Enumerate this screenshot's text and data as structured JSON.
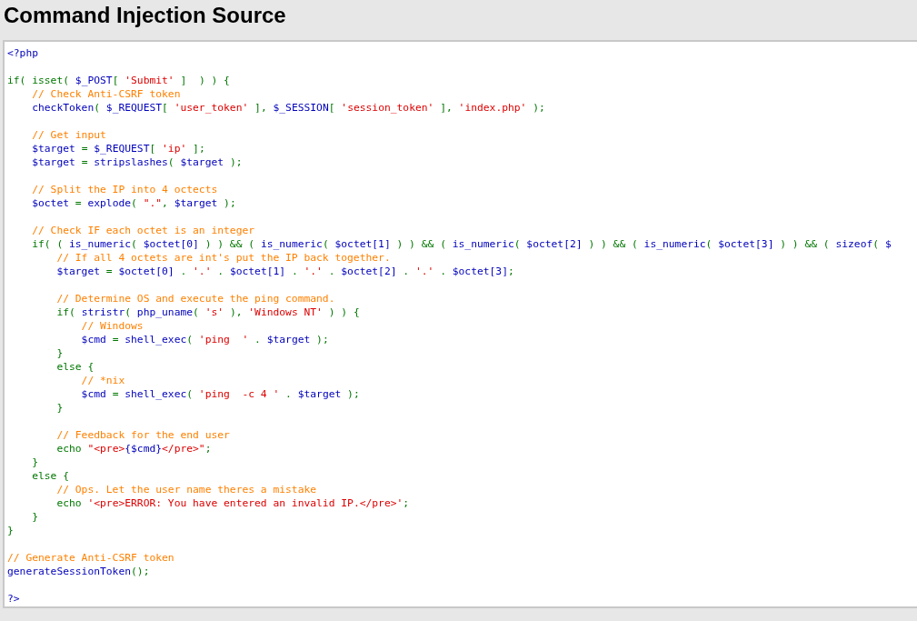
{
  "title": "Command Injection Source",
  "code_blocks": [
    [
      [
        {
          "kind": "code",
          "text": "<?php"
        }
      ]
    ],
    [
      [
        {
          "kind": "keyword",
          "text": "if( isset( "
        },
        {
          "kind": "code",
          "text": "$_POST"
        },
        {
          "kind": "keyword",
          "text": "[ "
        },
        {
          "kind": "string",
          "text": "'Submit'"
        },
        {
          "kind": "keyword",
          "text": " ]  ) ) {"
        }
      ],
      [
        {
          "kind": "comment",
          "text": "    // Check Anti-CSRF token"
        }
      ],
      [
        {
          "kind": "code",
          "text": "    checkToken"
        },
        {
          "kind": "keyword",
          "text": "( "
        },
        {
          "kind": "code",
          "text": "$_REQUEST"
        },
        {
          "kind": "keyword",
          "text": "[ "
        },
        {
          "kind": "string",
          "text": "'user_token'"
        },
        {
          "kind": "keyword",
          "text": " ], "
        },
        {
          "kind": "code",
          "text": "$_SESSION"
        },
        {
          "kind": "keyword",
          "text": "[ "
        },
        {
          "kind": "string",
          "text": "'session_token'"
        },
        {
          "kind": "keyword",
          "text": " ], "
        },
        {
          "kind": "string",
          "text": "'index.php'"
        },
        {
          "kind": "keyword",
          "text": " );"
        }
      ]
    ],
    [
      [
        {
          "kind": "comment",
          "text": "    // Get input"
        }
      ],
      [
        {
          "kind": "code",
          "text": "    $target "
        },
        {
          "kind": "keyword",
          "text": "= "
        },
        {
          "kind": "code",
          "text": "$_REQUEST"
        },
        {
          "kind": "keyword",
          "text": "[ "
        },
        {
          "kind": "string",
          "text": "'ip'"
        },
        {
          "kind": "keyword",
          "text": " ];"
        }
      ],
      [
        {
          "kind": "code",
          "text": "    $target "
        },
        {
          "kind": "keyword",
          "text": "= "
        },
        {
          "kind": "code",
          "text": "stripslashes"
        },
        {
          "kind": "keyword",
          "text": "( "
        },
        {
          "kind": "code",
          "text": "$target "
        },
        {
          "kind": "keyword",
          "text": ");"
        }
      ]
    ],
    [
      [
        {
          "kind": "comment",
          "text": "    // Split the IP into 4 octects"
        }
      ],
      [
        {
          "kind": "code",
          "text": "    $octet "
        },
        {
          "kind": "keyword",
          "text": "= "
        },
        {
          "kind": "code",
          "text": "explode"
        },
        {
          "kind": "keyword",
          "text": "( "
        },
        {
          "kind": "string",
          "text": "\".\""
        },
        {
          "kind": "keyword",
          "text": ", "
        },
        {
          "kind": "code",
          "text": "$target "
        },
        {
          "kind": "keyword",
          "text": ");"
        }
      ]
    ],
    [
      [
        {
          "kind": "comment",
          "text": "    // Check IF each octet is an integer"
        }
      ],
      [
        {
          "kind": "keyword",
          "text": "    if( ( "
        },
        {
          "kind": "code",
          "text": "is_numeric"
        },
        {
          "kind": "keyword",
          "text": "( "
        },
        {
          "kind": "code",
          "text": "$octet[0]"
        },
        {
          "kind": "keyword",
          "text": " ) ) && ( "
        },
        {
          "kind": "code",
          "text": "is_numeric"
        },
        {
          "kind": "keyword",
          "text": "( "
        },
        {
          "kind": "code",
          "text": "$octet[1]"
        },
        {
          "kind": "keyword",
          "text": " ) ) && ( "
        },
        {
          "kind": "code",
          "text": "is_numeric"
        },
        {
          "kind": "keyword",
          "text": "( "
        },
        {
          "kind": "code",
          "text": "$octet[2]"
        },
        {
          "kind": "keyword",
          "text": " ) ) && ( "
        },
        {
          "kind": "code",
          "text": "is_numeric"
        },
        {
          "kind": "keyword",
          "text": "( "
        },
        {
          "kind": "code",
          "text": "$octet[3]"
        },
        {
          "kind": "keyword",
          "text": " ) ) && ( "
        },
        {
          "kind": "code",
          "text": "sizeof"
        },
        {
          "kind": "keyword",
          "text": "( "
        },
        {
          "kind": "code",
          "text": "$"
        }
      ],
      [
        {
          "kind": "comment",
          "text": "        // If all 4 octets are int's put the IP back together."
        }
      ],
      [
        {
          "kind": "code",
          "text": "        $target "
        },
        {
          "kind": "keyword",
          "text": "= "
        },
        {
          "kind": "code",
          "text": "$octet[0] "
        },
        {
          "kind": "keyword",
          "text": ". "
        },
        {
          "kind": "string",
          "text": "'.'"
        },
        {
          "kind": "keyword",
          "text": " . "
        },
        {
          "kind": "code",
          "text": "$octet[1] "
        },
        {
          "kind": "keyword",
          "text": ". "
        },
        {
          "kind": "string",
          "text": "'.'"
        },
        {
          "kind": "keyword",
          "text": " . "
        },
        {
          "kind": "code",
          "text": "$octet[2] "
        },
        {
          "kind": "keyword",
          "text": ". "
        },
        {
          "kind": "string",
          "text": "'.'"
        },
        {
          "kind": "keyword",
          "text": " . "
        },
        {
          "kind": "code",
          "text": "$octet[3]"
        },
        {
          "kind": "keyword",
          "text": ";"
        }
      ]
    ],
    [
      [
        {
          "kind": "comment",
          "text": "        // Determine OS and execute the ping command."
        }
      ],
      [
        {
          "kind": "keyword",
          "text": "        if( "
        },
        {
          "kind": "code",
          "text": "stristr"
        },
        {
          "kind": "keyword",
          "text": "( "
        },
        {
          "kind": "code",
          "text": "php_uname"
        },
        {
          "kind": "keyword",
          "text": "( "
        },
        {
          "kind": "string",
          "text": "'s'"
        },
        {
          "kind": "keyword",
          "text": " ), "
        },
        {
          "kind": "string",
          "text": "'Windows NT'"
        },
        {
          "kind": "keyword",
          "text": " ) ) {"
        }
      ],
      [
        {
          "kind": "comment",
          "text": "            // Windows"
        }
      ],
      [
        {
          "kind": "code",
          "text": "            $cmd "
        },
        {
          "kind": "keyword",
          "text": "= "
        },
        {
          "kind": "code",
          "text": "shell_exec"
        },
        {
          "kind": "keyword",
          "text": "( "
        },
        {
          "kind": "string",
          "text": "'ping  '"
        },
        {
          "kind": "keyword",
          "text": " . "
        },
        {
          "kind": "code",
          "text": "$target "
        },
        {
          "kind": "keyword",
          "text": ");"
        }
      ],
      [
        {
          "kind": "keyword",
          "text": "        }"
        }
      ],
      [
        {
          "kind": "keyword",
          "text": "        else {"
        }
      ],
      [
        {
          "kind": "comment",
          "text": "            // *nix"
        }
      ],
      [
        {
          "kind": "code",
          "text": "            $cmd "
        },
        {
          "kind": "keyword",
          "text": "= "
        },
        {
          "kind": "code",
          "text": "shell_exec"
        },
        {
          "kind": "keyword",
          "text": "( "
        },
        {
          "kind": "string",
          "text": "'ping  -c 4 '"
        },
        {
          "kind": "keyword",
          "text": " . "
        },
        {
          "kind": "code",
          "text": "$target "
        },
        {
          "kind": "keyword",
          "text": ");"
        }
      ],
      [
        {
          "kind": "keyword",
          "text": "        }"
        }
      ]
    ],
    [
      [
        {
          "kind": "comment",
          "text": "        // Feedback for the end user"
        }
      ],
      [
        {
          "kind": "keyword",
          "text": "        echo "
        },
        {
          "kind": "string",
          "text": "\"<pre>"
        },
        {
          "kind": "code",
          "text": "{$cmd}"
        },
        {
          "kind": "string",
          "text": "</pre>\""
        },
        {
          "kind": "keyword",
          "text": ";"
        }
      ],
      [
        {
          "kind": "keyword",
          "text": "    }"
        }
      ],
      [
        {
          "kind": "keyword",
          "text": "    else {"
        }
      ],
      [
        {
          "kind": "comment",
          "text": "        // Ops. Let the user name theres a mistake"
        }
      ],
      [
        {
          "kind": "keyword",
          "text": "        echo "
        },
        {
          "kind": "string",
          "text": "'<pre>ERROR: You have entered an invalid IP.</pre>'"
        },
        {
          "kind": "keyword",
          "text": ";"
        }
      ],
      [
        {
          "kind": "keyword",
          "text": "    }"
        }
      ],
      [
        {
          "kind": "keyword",
          "text": "}"
        }
      ]
    ],
    [
      [
        {
          "kind": "comment",
          "text": "// Generate Anti-CSRF token"
        }
      ],
      [
        {
          "kind": "code",
          "text": "generateSessionToken"
        },
        {
          "kind": "keyword",
          "text": "();"
        }
      ]
    ],
    [
      [
        {
          "kind": "code",
          "text": "?>"
        }
      ]
    ]
  ]
}
